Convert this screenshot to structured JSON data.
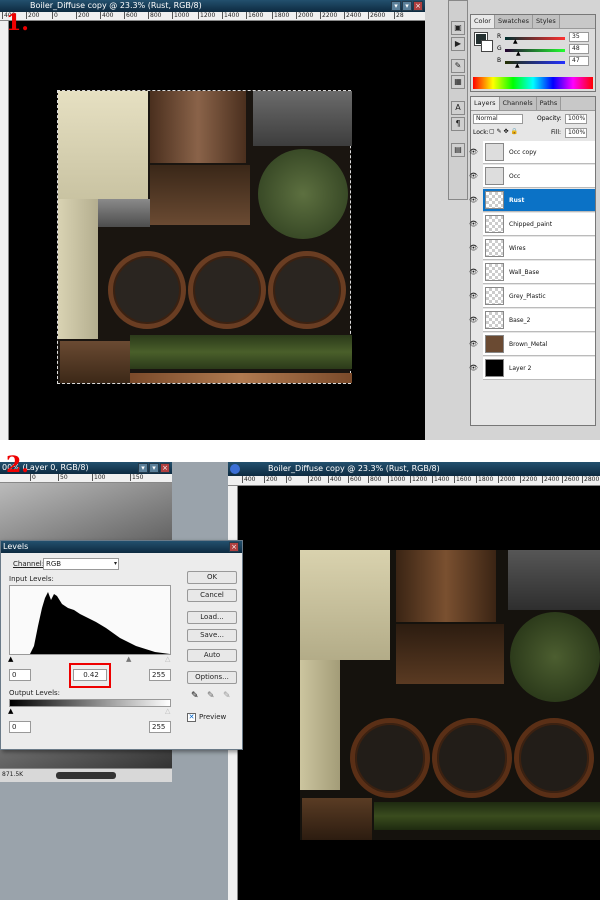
{
  "step_labels": {
    "one": "1.",
    "two": "2."
  },
  "top_window": {
    "title": "Boiler_Diffuse copy @ 23.3% (Rust, RGB/8)",
    "ruler_ticks": [
      "400",
      "200",
      "0",
      "200",
      "400",
      "600",
      "800",
      "1000",
      "1200",
      "1400",
      "1600",
      "1800",
      "2000",
      "2200",
      "2400",
      "2600",
      "28"
    ]
  },
  "color_panel": {
    "tabs": [
      "Color",
      "Swatches",
      "Styles"
    ],
    "channels": [
      {
        "label": "R",
        "value": "35"
      },
      {
        "label": "G",
        "value": "48"
      },
      {
        "label": "B",
        "value": "47"
      }
    ],
    "channel_fractions": [
      0.14,
      0.19,
      0.18
    ]
  },
  "layers_panel": {
    "tabs": [
      "Layers",
      "Channels",
      "Paths"
    ],
    "blend_mode": "Normal",
    "opacity_label": "Opacity:",
    "opacity_value": "100%",
    "lock_label": "Lock:",
    "fill_label": "Fill:",
    "fill_value": "100%",
    "layers": [
      "Occ copy",
      "Occ",
      "Rust",
      "Chipped_paint",
      "Wires",
      "Wall_Base",
      "Grey_Plastic",
      "Base_2",
      "Brown_Metal",
      "Layer 2"
    ],
    "selected": "Rust"
  },
  "bottom_left_window": {
    "title": "00% (Layer 0, RGB/8)",
    "ruler_ticks": [
      "0",
      "50",
      "100",
      "150"
    ],
    "status": "871.5K"
  },
  "levels_dialog": {
    "title": "Levels",
    "channel_label": "Channel:",
    "channel_value": "RGB",
    "input_levels_label": "Input Levels:",
    "input_black": "0",
    "input_gamma": "0.42",
    "input_white": "255",
    "output_levels_label": "Output Levels:",
    "output_black": "0",
    "output_white": "255",
    "buttons": {
      "ok": "OK",
      "cancel": "Cancel",
      "load": "Load...",
      "save": "Save...",
      "auto": "Auto",
      "options": "Options..."
    },
    "preview_label": "Preview"
  },
  "bottom_right_window": {
    "title": "Boiler_Diffuse copy @ 23.3% (Rust, RGB/8)",
    "ruler_ticks": [
      "400",
      "200",
      "0",
      "200",
      "400",
      "600",
      "800",
      "1000",
      "1200",
      "1400",
      "1600",
      "1800",
      "2000",
      "2200",
      "2400",
      "2600",
      "2800"
    ]
  },
  "tool_icons": [
    "move-icon",
    "type-icon",
    "paragraph-icon",
    "note-icon"
  ]
}
